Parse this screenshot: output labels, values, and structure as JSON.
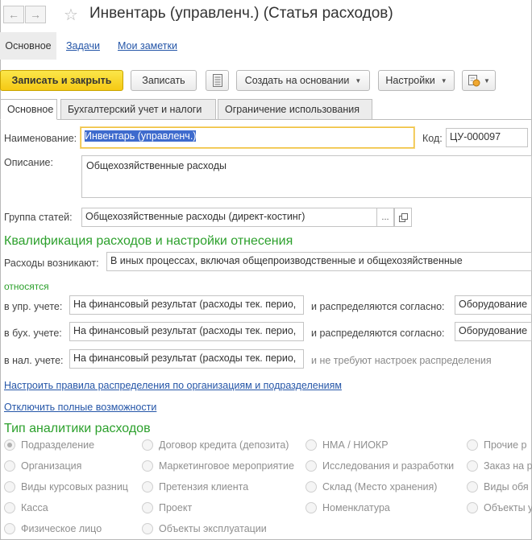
{
  "window": {
    "title": "Инвентарь (управленч.) (Статья расходов)",
    "back_icon": "arrow-left",
    "forward_icon": "arrow-right",
    "favorite_icon": "star"
  },
  "nav": {
    "main": "Основное",
    "tasks": "Задачи",
    "notes": "Мои заметки"
  },
  "toolbar": {
    "save_close": "Записать и закрыть",
    "save": "Записать",
    "create_based": "Создать на основании",
    "settings": "Настройки"
  },
  "tabs": [
    "Основное",
    "Бухгалтерский учет и налоги",
    "Ограничение использования"
  ],
  "form": {
    "name_label": "Наименование:",
    "name_value": "Инвентарь (управленч.)",
    "code_label": "Код:",
    "code_value": "ЦУ-000097",
    "desc_label": "Описание:",
    "desc_value": "Общехозяйственные расходы",
    "group_label": "Группа статей:",
    "group_value": "Общехозяйственные расходы (директ-костинг)",
    "more_btn": "..."
  },
  "qualification": {
    "header": "Квалификация расходов и настройки отнесения",
    "arise_label": "Расходы возникают:",
    "arise_value": "В иных процессах, включая общепроизводственные и общехозяйственные",
    "relate_label": "относятся",
    "mgmt_label": "в упр. учете:",
    "mgmt_value": "На финансовый результат (расходы тек. перио,",
    "acc_label": "в бух. учете:",
    "acc_value": "На финансовый результат (расходы тек. перио,",
    "tax_label": "в нал. учете:",
    "tax_value": "На финансовый результат (расходы тек. перио,",
    "distr_label": "и распределяются согласно:",
    "distr_value_mgmt": "Оборудование",
    "distr_value_acc": "Оборудование",
    "no_setup": "и не требуют настроек распределения",
    "rules_link": "Настроить правила распределения по организациям и подразделениям"
  },
  "disable_link": "Отключить полные возможности",
  "analytics": {
    "header": "Тип аналитики расходов",
    "options": [
      [
        "Подразделение",
        "Договор кредита (депозита)",
        "НМА / НИОКР",
        "Прочие р"
      ],
      [
        "Организация",
        "Маркетинговое мероприятие",
        "Исследования и разработки",
        "Заказ на р"
      ],
      [
        "Виды курсовых разниц",
        "Претензия клиента",
        "Склад (Место хранения)",
        "Виды обя"
      ],
      [
        "Касса",
        "Проект",
        "Номенклатура",
        "Объекты у"
      ],
      [
        "Физическое лицо",
        "Объекты эксплуатации"
      ]
    ]
  }
}
